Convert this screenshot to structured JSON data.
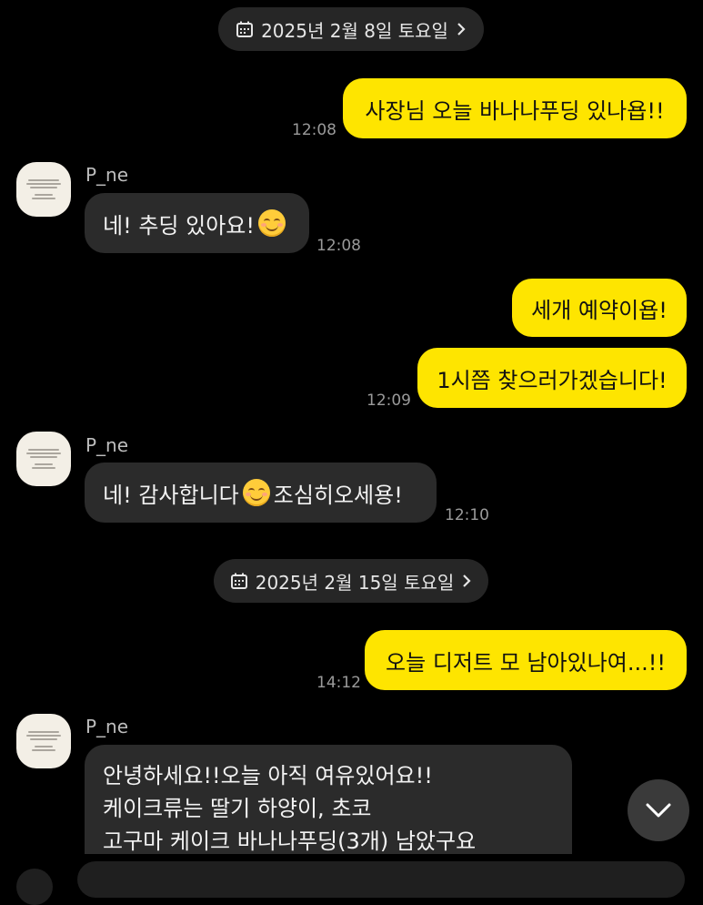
{
  "dates": [
    {
      "label": "2025년 2월 8일 토요일"
    },
    {
      "label": "2025년 2월 15일 토요일"
    }
  ],
  "messages": [
    {
      "from": "me",
      "text": "사장님 오늘 바나나푸딩 있나욥!!",
      "time": "12:08"
    },
    {
      "from": "other",
      "sender": "P_ne",
      "text": "네! 추딩 있아요!",
      "time": "12:08"
    },
    {
      "from": "me",
      "text": "세개 예약이욥!"
    },
    {
      "from": "me",
      "text": "1시쯤 찾으러가겠습니다!",
      "time": "12:09"
    },
    {
      "from": "other",
      "sender": "P_ne",
      "text_before": "네! 감사합니다",
      "text_after": "조심히오세용!",
      "time": "12:10"
    },
    {
      "from": "me",
      "text": "오늘 디저트 모 남아있나여...!!",
      "time": "14:12"
    },
    {
      "from": "other",
      "sender": "P_ne",
      "lines": [
        "안녕하세요!!오늘 아직 여유있어요!!",
        "케이크류는 딸기 하양이, 초코",
        "고구마 케이크 바나나푸딩(3개) 남았구요"
      ]
    }
  ],
  "icons": {
    "date": "calendar-icon",
    "date_arrow": "chevron-right-icon",
    "scroll": "chevron-down-icon",
    "emoji": "smiling-face-emoji"
  },
  "colors": {
    "background": "#000000",
    "my_bubble": "#fee500",
    "other_bubble": "#2b2b2b",
    "date_pill": "#262626"
  }
}
